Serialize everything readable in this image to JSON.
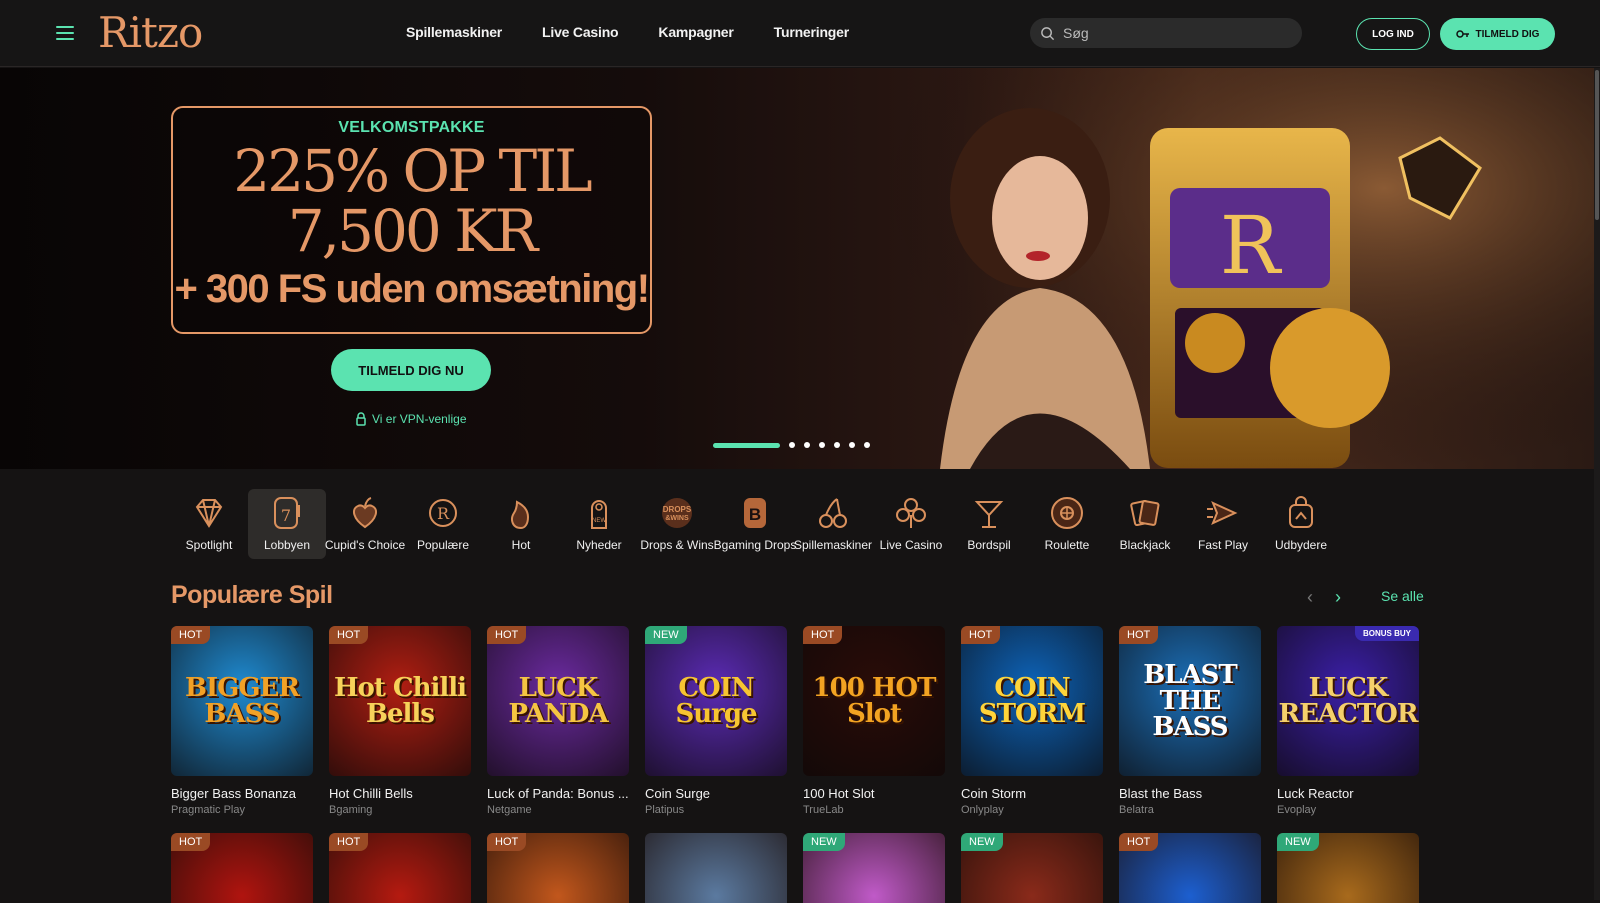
{
  "header": {
    "logo": "Ritzo",
    "nav": [
      "Spillemaskiner",
      "Live Casino",
      "Kampagner",
      "Turneringer"
    ],
    "search_placeholder": "Søg",
    "login_label": "LOG IND",
    "signup_label": "TILMELD DIG"
  },
  "hero": {
    "eyebrow": "VELKOMSTPAKKE",
    "line1": "225% OP TIL",
    "line2": "7,500 KR",
    "line3": "+ 300 FS uden omsætning!",
    "cta": "TILMELD DIG NU",
    "vpn": "Vi er VPN-venlige",
    "slides": 7,
    "active_slide": 1
  },
  "categories": [
    {
      "label": "Spotlight",
      "icon": "diamond-icon"
    },
    {
      "label": "Lobbyen",
      "icon": "seven-slot-icon",
      "active": true
    },
    {
      "label": "Cupid's Choice",
      "icon": "heart-apple-icon"
    },
    {
      "label": "Populære",
      "icon": "laurel-r-icon"
    },
    {
      "label": "Hot",
      "icon": "flame-icon"
    },
    {
      "label": "Nyheder",
      "icon": "door-hanger-new-icon"
    },
    {
      "label": "Drops & Wins",
      "icon": "drops-wins-icon"
    },
    {
      "label": "Bgaming Drops",
      "icon": "bgaming-b-icon"
    },
    {
      "label": "Spillemaskiner",
      "icon": "cherry-icon"
    },
    {
      "label": "Live Casino",
      "icon": "club-icon"
    },
    {
      "label": "Bordspil",
      "icon": "cocktail-icon"
    },
    {
      "label": "Roulette",
      "icon": "roulette-icon"
    },
    {
      "label": "Blackjack",
      "icon": "cards-icon"
    },
    {
      "label": "Fast Play",
      "icon": "fast-play-icon"
    },
    {
      "label": "Udbydere",
      "icon": "provider-bag-icon"
    }
  ],
  "section": {
    "title": "Populære Spil",
    "see_all": "Se alle"
  },
  "games": [
    {
      "name": "Bigger Bass Bonanza",
      "provider": "Pragmatic Play",
      "badge": "HOT",
      "art": "BIGGER BASS",
      "bg": "#1f8ad0",
      "fg": "#f2a126"
    },
    {
      "name": "Hot Chilli Bells",
      "provider": "Bgaming",
      "badge": "HOT",
      "art": "Hot Chilli Bells",
      "bg": "#b01e12",
      "fg": "#f7d25a"
    },
    {
      "name": "Luck of Panda: Bonus ...",
      "provider": "Netgame",
      "badge": "HOT",
      "art": "LUCK PANDA",
      "bg": "#6b2aa0",
      "fg": "#f5c542"
    },
    {
      "name": "Coin Surge",
      "provider": "Platipus",
      "badge": "NEW",
      "art": "COIN Surge",
      "bg": "#5b2bb5",
      "fg": "#f7c531"
    },
    {
      "name": "100 Hot Slot",
      "provider": "TrueLab",
      "badge": "HOT",
      "art": "100 HOT Slot",
      "bg": "#2a0c08",
      "fg": "#f2a322"
    },
    {
      "name": "Coin Storm",
      "provider": "Onlyplay",
      "badge": "HOT",
      "art": "COIN STORM",
      "bg": "#0d63b8",
      "fg": "#ffd43a"
    },
    {
      "name": "Blast the Bass",
      "provider": "Belatra",
      "badge": "HOT",
      "art": "BLAST THE BASS",
      "bg": "#1b6fb8",
      "fg": "#ffffff"
    },
    {
      "name": "Luck Reactor",
      "provider": "Evoplay",
      "badge": "BONUS BUY",
      "art": "LUCK REACTOR",
      "bg": "#3b1fa8",
      "fg": "#f5d06b"
    }
  ],
  "games_row2": [
    {
      "badge": "HOT",
      "bg": "#b0140f"
    },
    {
      "badge": "HOT",
      "bg": "#b51a10"
    },
    {
      "badge": "HOT",
      "bg": "#c2571c"
    },
    {
      "badge": "",
      "bg": "#5b7aa0"
    },
    {
      "badge": "NEW",
      "bg": "#c05ac8"
    },
    {
      "badge": "NEW",
      "bg": "#8a2a1a"
    },
    {
      "badge": "HOT",
      "bg": "#1c5fd0"
    },
    {
      "badge": "NEW",
      "bg": "#a86a1c"
    }
  ],
  "colors": {
    "accent": "#5be3b0",
    "brand": "#e59867",
    "bg": "#151313"
  }
}
